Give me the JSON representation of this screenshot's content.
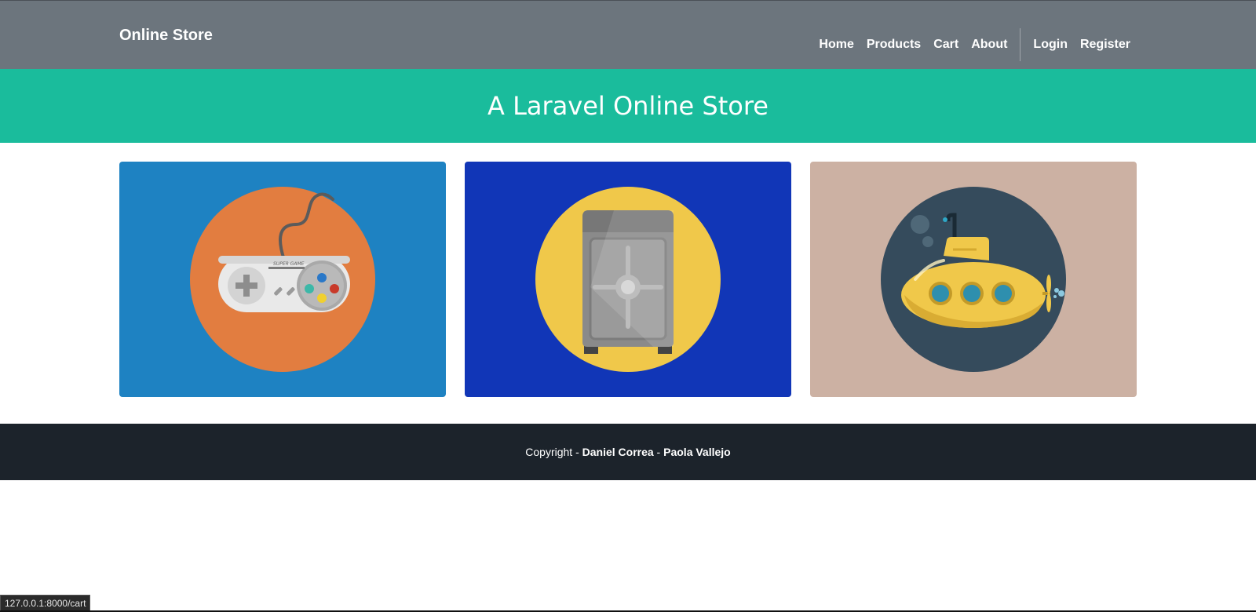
{
  "navbar": {
    "brand": "Online Store",
    "links": [
      "Home",
      "Products",
      "Cart",
      "About"
    ],
    "auth_links": [
      "Login",
      "Register"
    ]
  },
  "masthead": {
    "title": "A Laravel Online Store"
  },
  "cards": [
    {
      "icon": "game-controller-icon",
      "bg": "#1e82c2",
      "circle": "#e27d40"
    },
    {
      "icon": "safe-icon",
      "bg": "#1136b7",
      "circle": "#f0c84a"
    },
    {
      "icon": "submarine-icon",
      "bg": "#ccb1a3",
      "circle": "#354b5c"
    }
  ],
  "footer": {
    "prefix": "Copyright - ",
    "author1": "Daniel Correa",
    "separator": " - ",
    "author2": "Paola Vallejo"
  },
  "status_bar": {
    "url": "127.0.0.1:8000/cart"
  },
  "colors": {
    "navbar": "#6c757d",
    "masthead": "#1abc9c",
    "footer": "#1c232b"
  }
}
